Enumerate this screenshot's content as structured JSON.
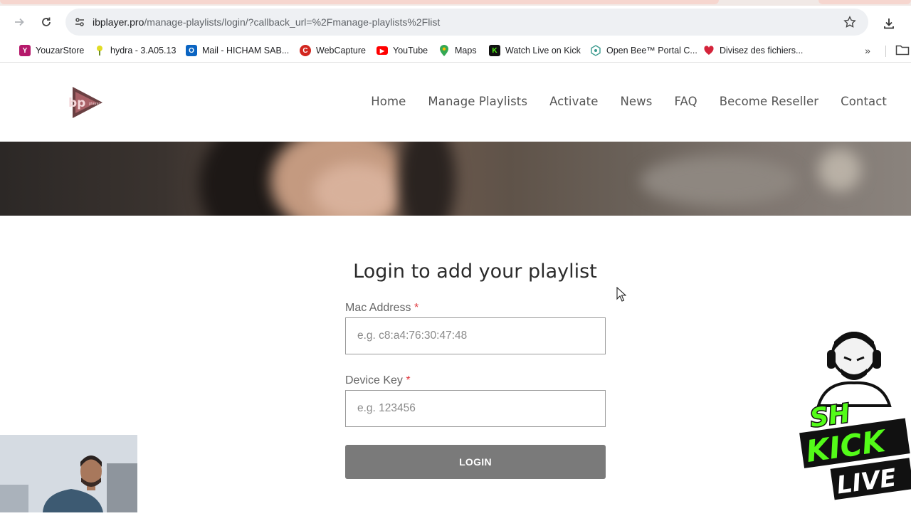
{
  "browser": {
    "url_host": "ibplayer.pro",
    "url_path": "/manage-playlists/login/?callback_url=%2Fmanage-playlists%2Flist",
    "icons": {
      "forward": "forward-arrow-icon",
      "reload": "reload-icon",
      "site_info": "tune-icon",
      "bookmark": "star-icon",
      "downloads": "download-icon"
    },
    "bookmarks": [
      {
        "label": "YouzarStore",
        "icon": "youzarstore-icon",
        "color": "#b5196b",
        "glyph": "Y"
      },
      {
        "label": "hydra - 3.A05.13",
        "icon": "hydra-icon",
        "color": "#c6c41c",
        "glyph": ""
      },
      {
        "label": "Mail - HICHAM SAB...",
        "icon": "outlook-icon",
        "color": "#0a64c2",
        "glyph": "O"
      },
      {
        "label": "WebCapture",
        "icon": "webcapture-icon",
        "color": "#d2261f",
        "glyph": "C"
      },
      {
        "label": "YouTube",
        "icon": "youtube-icon",
        "color": "#ff0000",
        "glyph": "▶"
      },
      {
        "label": "Maps",
        "icon": "maps-icon",
        "color": "#34a853",
        "glyph": ""
      },
      {
        "label": "Watch Live on Kick",
        "icon": "kick-icon",
        "color": "#18b51c",
        "glyph": "K"
      },
      {
        "label": "Open Bee™ Portal C...",
        "icon": "openbee-icon",
        "color": "#3a9a8e",
        "glyph": ""
      },
      {
        "label": "Divisez des fichiers...",
        "icon": "heart-icon",
        "color": "#d4233a",
        "glyph": ""
      }
    ]
  },
  "site": {
    "logo_text": "bp",
    "logo_sub": "player",
    "nav": [
      "Home",
      "Manage Playlists",
      "Activate",
      "News",
      "FAQ",
      "Become Reseller",
      "Contact"
    ]
  },
  "login": {
    "title": "Login to add your playlist",
    "mac_label": "Mac Address",
    "mac_placeholder": "e.g. c8:a4:76:30:47:48",
    "key_label": "Device Key",
    "key_placeholder": "e.g. 123456",
    "required_mark": "*",
    "button": "LOGIN"
  },
  "overlay": {
    "badge_line1": "SH",
    "badge_line2": "KICK",
    "badge_line3": "LIVE"
  }
}
